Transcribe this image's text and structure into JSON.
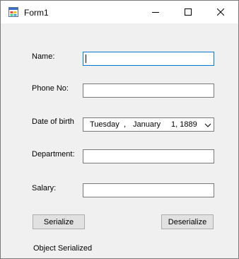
{
  "window": {
    "title": "Form1"
  },
  "fields": {
    "name_label": "Name:",
    "name_value": "",
    "phone_label": "Phone No:",
    "phone_value": "",
    "dob_label": "Date of birth",
    "dob_weekday": "Tuesday",
    "dob_comma1": ",",
    "dob_month": "January",
    "dob_day_year": "1, 1889",
    "department_label": "Department:",
    "department_value": "",
    "salary_label": "Salary:",
    "salary_value": ""
  },
  "buttons": {
    "serialize": "Serialize",
    "deserialize": "Deserialize"
  },
  "status": {
    "text": "Object Serialized"
  },
  "icons": {
    "app": "form-icon",
    "minimize": "minimize-icon",
    "maximize": "maximize-icon",
    "close": "close-icon",
    "dropdown": "chevron-down-icon"
  },
  "colors": {
    "focus_border": "#0078d7",
    "form_background": "#f0f0f0",
    "button_face": "#e1e1e1"
  }
}
